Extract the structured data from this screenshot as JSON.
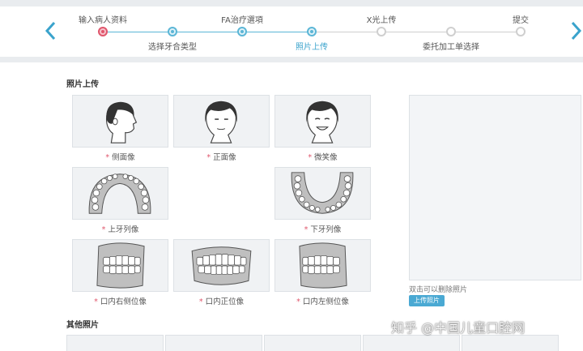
{
  "stepper": {
    "steps": [
      {
        "label": "输入病人资料",
        "status": "current"
      },
      {
        "label": "选择牙合类型",
        "status": "done"
      },
      {
        "label": "FA治疗選項",
        "status": "done"
      },
      {
        "label": "照片上传",
        "status": "active"
      },
      {
        "label": "X光上传",
        "status": "todo"
      },
      {
        "label": "委托加工单选择",
        "status": "todo"
      },
      {
        "label": "提交",
        "status": "todo"
      }
    ]
  },
  "photo_section": {
    "title": "照片上传",
    "required_mark": "*",
    "slots": [
      {
        "label": "侧面像",
        "icon": "face-profile-icon"
      },
      {
        "label": "正面像",
        "icon": "face-front-icon"
      },
      {
        "label": "微笑像",
        "icon": "face-smile-icon"
      },
      {
        "label": "上牙列像",
        "icon": "upper-arch-icon"
      },
      {
        "label": "下牙列像",
        "icon": "lower-arch-icon"
      },
      {
        "label": "口内右侧位像",
        "icon": "teeth-right-icon"
      },
      {
        "label": "口内正位像",
        "icon": "teeth-front-icon"
      },
      {
        "label": "口内左侧位像",
        "icon": "teeth-left-icon"
      }
    ]
  },
  "preview": {
    "hint": "双击可以删除照片",
    "upload_button": "上传照片"
  },
  "other_section": {
    "title": "其他照片"
  },
  "watermark": "知乎 @中国儿童口腔网",
  "colors": {
    "accent": "#4aa9d3",
    "step_line": "#5bb6d6",
    "required": "#e0566c",
    "slot_bg": "#f0f2f4"
  }
}
